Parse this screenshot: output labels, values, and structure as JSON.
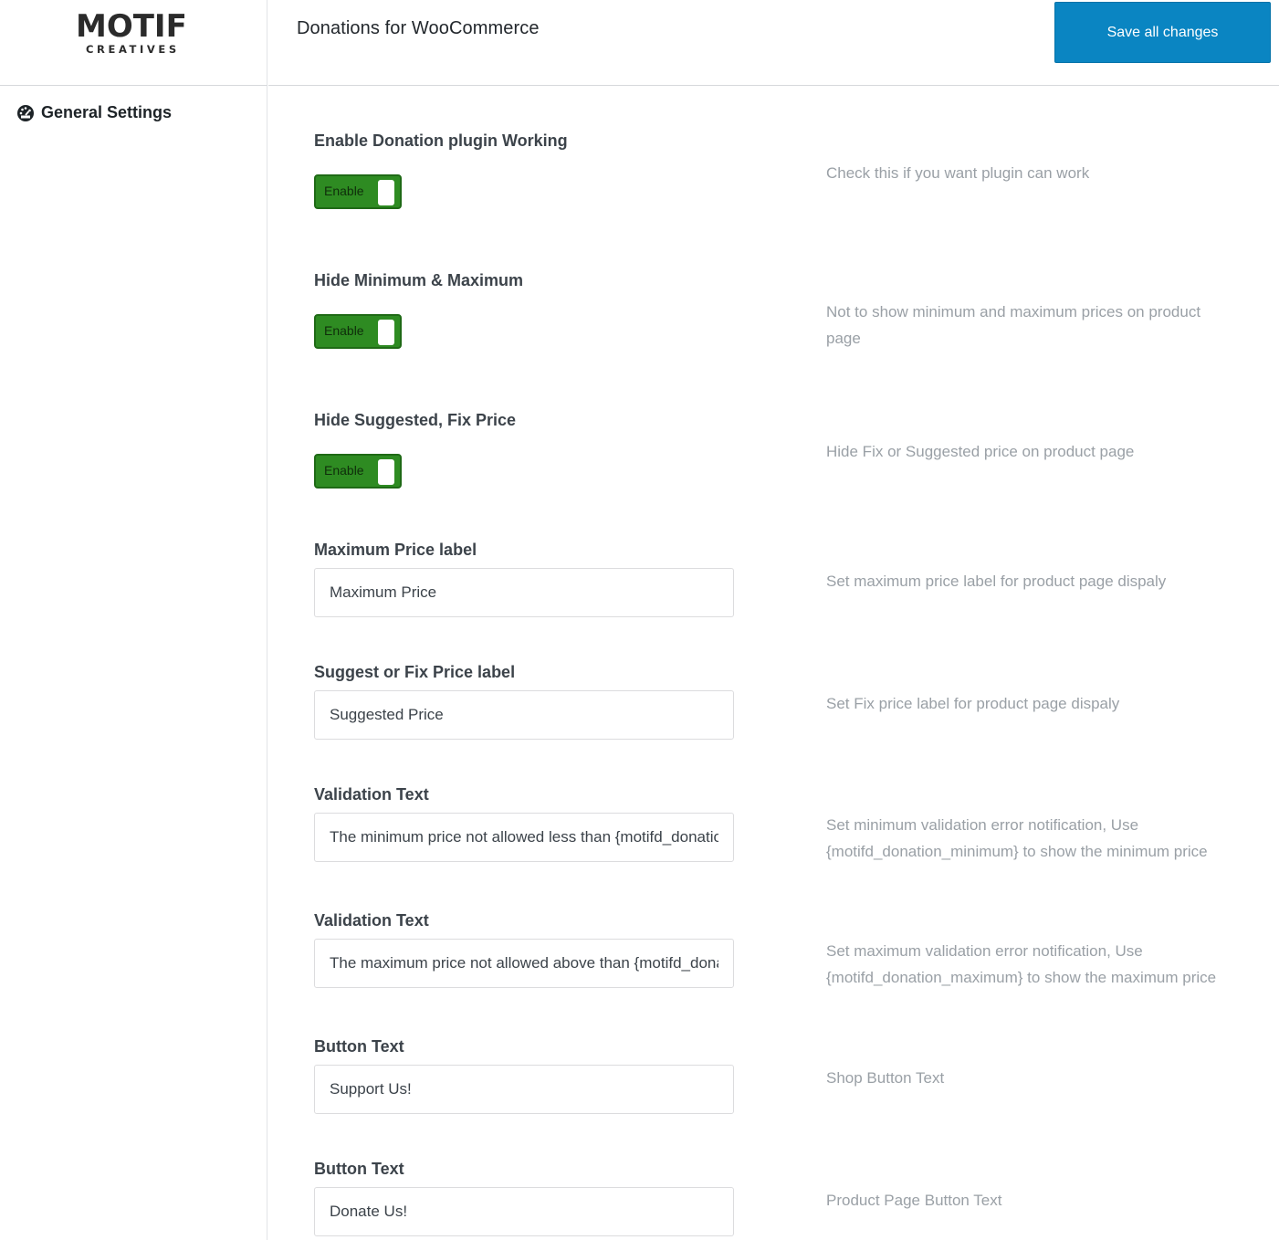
{
  "brand": {
    "name": "MOTIF",
    "tagline": "CREATIVES"
  },
  "sidebar": {
    "items": [
      {
        "label": "General Settings",
        "icon": "dashboard-gauge-icon"
      }
    ]
  },
  "header": {
    "title": "Donations for WooCommerce",
    "save_label": "Save all changes"
  },
  "colors": {
    "accent": "#0a85c2",
    "toggle_on": "#2e8b22",
    "description": "#9aa0a6"
  },
  "settings": [
    {
      "label": "Enable Donation plugin Working",
      "type": "toggle",
      "value": "Enable",
      "description": "Check this if you want plugin can work"
    },
    {
      "label": "Hide Minimum & Maximum",
      "type": "toggle",
      "value": "Enable",
      "description": "Not to show minimum and maximum prices on product page"
    },
    {
      "label": "Hide Suggested, Fix Price",
      "type": "toggle",
      "value": "Enable",
      "description": "Hide Fix or Suggested price on product page"
    },
    {
      "label": "Maximum Price label",
      "type": "text",
      "value": "Maximum Price",
      "description": "Set maximum price label for product page dispaly"
    },
    {
      "label": "Suggest or Fix Price label",
      "type": "text",
      "value": "Suggested Price",
      "description": "Set Fix price label for product page dispaly"
    },
    {
      "label": "Validation Text",
      "type": "text",
      "value": "The minimum price not allowed less than {motifd_donation_minimum}",
      "description": "Set minimum validation error notification, Use {motifd_donation_minimum} to show the minimum price"
    },
    {
      "label": "Validation Text",
      "type": "text",
      "value": "The maximum price not allowed above than {motifd_donation_maximum}",
      "description": "Set maximum validation error notification, Use {motifd_donation_maximum} to show the maximum price"
    },
    {
      "label": "Button Text",
      "type": "text",
      "value": "Support Us!",
      "description": "Shop Button Text"
    },
    {
      "label": "Button Text",
      "type": "text",
      "value": "Donate Us!",
      "description": "Product Page Button Text"
    }
  ]
}
